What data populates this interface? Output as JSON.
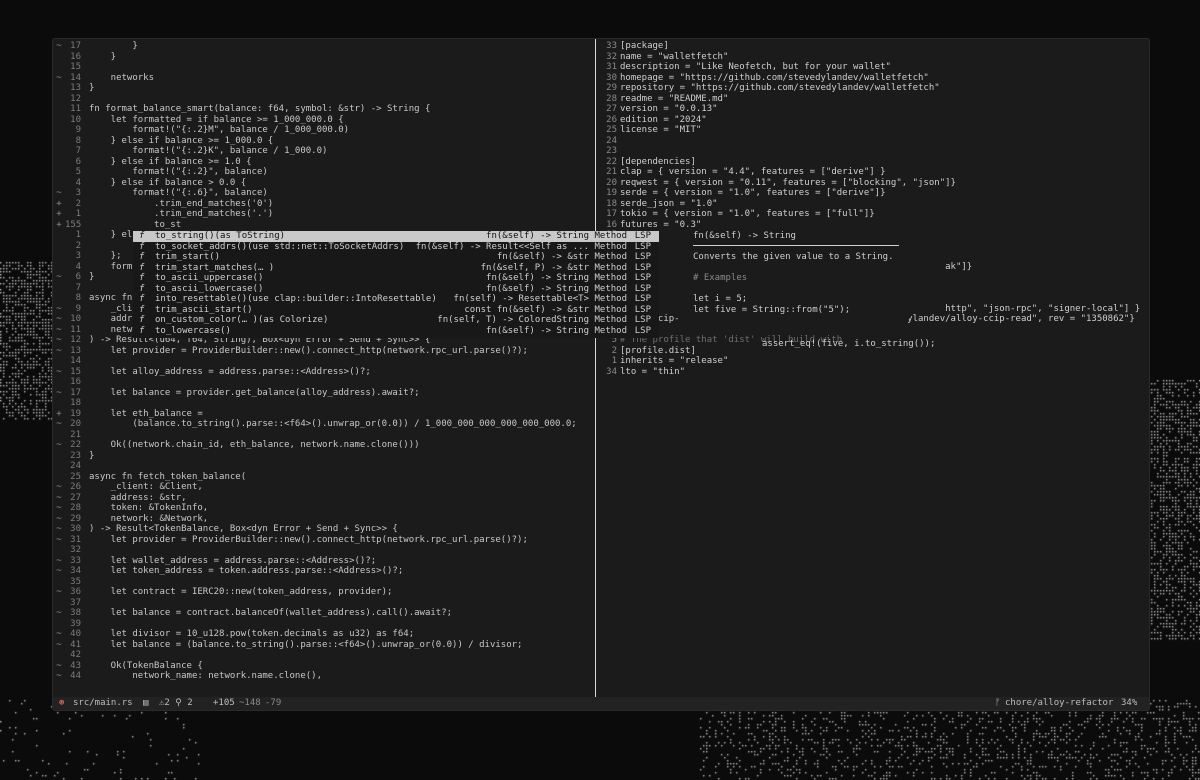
{
  "left_pane": {
    "lines": [
      {
        "g": "~",
        "n": "17",
        "t": "        }"
      },
      {
        "g": "",
        "n": "16",
        "t": "    }"
      },
      {
        "g": "",
        "n": "15",
        "t": ""
      },
      {
        "g": "~",
        "n": "14",
        "t": "    networks"
      },
      {
        "g": "",
        "n": "13",
        "t": "}"
      },
      {
        "g": "",
        "n": "12",
        "t": ""
      },
      {
        "g": "",
        "n": "11",
        "t": "fn format_balance_smart(balance: f64, symbol: &str) -> String {"
      },
      {
        "g": "",
        "n": "10",
        "t": "    let formatted = if balance >= 1_000_000.0 {"
      },
      {
        "g": "",
        "n": "9",
        "t": "        format!(\"{:.2}M\", balance / 1_000_000.0)"
      },
      {
        "g": "",
        "n": "8",
        "t": "    } else if balance >= 1_000.0 {"
      },
      {
        "g": "",
        "n": "7",
        "t": "        format!(\"{:.2}K\", balance / 1_000.0)"
      },
      {
        "g": "",
        "n": "6",
        "t": "    } else if balance >= 1.0 {"
      },
      {
        "g": "",
        "n": "5",
        "t": "        format!(\"{:.2}\", balance)"
      },
      {
        "g": "",
        "n": "4",
        "t": "    } else if balance > 0.0 {"
      },
      {
        "g": "~",
        "n": "3",
        "t": "        format!(\"{:.6}\", balance)"
      },
      {
        "g": "+",
        "n": "2",
        "t": "            .trim_end_matches('0')"
      },
      {
        "g": "+",
        "n": "1",
        "t": "            .trim_end_matches('.')"
      },
      {
        "g": "+",
        "n": "155",
        "t": "            to_st"
      },
      {
        "g": "",
        "n": "1",
        "t": "    } else"
      },
      {
        "g": "",
        "n": "2",
        "t": "        \""
      },
      {
        "g": "",
        "n": "3",
        "t": "    };"
      },
      {
        "g": "",
        "n": "4",
        "t": "    forma"
      },
      {
        "g": "~",
        "n": "6",
        "t": "}"
      },
      {
        "g": "",
        "n": "7",
        "t": ""
      },
      {
        "g": "",
        "n": "8",
        "t": "async fn"
      },
      {
        "g": "~",
        "n": "9",
        "t": "    _clie"
      },
      {
        "g": "~",
        "n": "10",
        "t": "    addre"
      },
      {
        "g": "~",
        "n": "11",
        "t": "    network: &Network,"
      },
      {
        "g": "~",
        "n": "12",
        "t": ") -> Result<(u64, f64, String), Box<dyn Error + Send + Sync>> {"
      },
      {
        "g": "~",
        "n": "13",
        "t": "    let provider = ProviderBuilder::new().connect_http(network.rpc_url.parse()?);"
      },
      {
        "g": "",
        "n": "14",
        "t": ""
      },
      {
        "g": "~",
        "n": "15",
        "t": "    let alloy_address = address.parse::<Address>()?;"
      },
      {
        "g": "",
        "n": "16",
        "t": ""
      },
      {
        "g": "~",
        "n": "17",
        "t": "    let balance = provider.get_balance(alloy_address).await?;"
      },
      {
        "g": "",
        "n": "18",
        "t": ""
      },
      {
        "g": "+",
        "n": "19",
        "t": "    let eth_balance ="
      },
      {
        "g": "~",
        "n": "20",
        "t": "        (balance.to_string().parse::<f64>().unwrap_or(0.0)) / 1_000_000_000_000_000_000.0;"
      },
      {
        "g": "",
        "n": "21",
        "t": ""
      },
      {
        "g": "~",
        "n": "22",
        "t": "    Ok((network.chain_id, eth_balance, network.name.clone()))"
      },
      {
        "g": "",
        "n": "23",
        "t": "}"
      },
      {
        "g": "",
        "n": "24",
        "t": ""
      },
      {
        "g": "",
        "n": "25",
        "t": "async fn fetch_token_balance("
      },
      {
        "g": "~",
        "n": "26",
        "t": "    _client: &Client,"
      },
      {
        "g": "~",
        "n": "27",
        "t": "    address: &str,"
      },
      {
        "g": "~",
        "n": "28",
        "t": "    token: &TokenInfo,"
      },
      {
        "g": "~",
        "n": "29",
        "t": "    network: &Network,"
      },
      {
        "g": "~",
        "n": "30",
        "t": ") -> Result<TokenBalance, Box<dyn Error + Send + Sync>> {"
      },
      {
        "g": "~",
        "n": "31",
        "t": "    let provider = ProviderBuilder::new().connect_http(network.rpc_url.parse()?);"
      },
      {
        "g": "",
        "n": "32",
        "t": ""
      },
      {
        "g": "~",
        "n": "33",
        "t": "    let wallet_address = address.parse::<Address>()?;"
      },
      {
        "g": "~",
        "n": "34",
        "t": "    let token_address = token.address.parse::<Address>()?;"
      },
      {
        "g": "",
        "n": "35",
        "t": ""
      },
      {
        "g": "~",
        "n": "36",
        "t": "    let contract = IERC20::new(token_address, provider);"
      },
      {
        "g": "",
        "n": "37",
        "t": ""
      },
      {
        "g": "~",
        "n": "38",
        "t": "    let balance = contract.balanceOf(wallet_address).call().await?;"
      },
      {
        "g": "",
        "n": "39",
        "t": ""
      },
      {
        "g": "~",
        "n": "40",
        "t": "    let divisor = 10_u128.pow(token.decimals as u32) as f64;"
      },
      {
        "g": "~",
        "n": "41",
        "t": "    let balance = (balance.to_string().parse::<f64>().unwrap_or(0.0)) / divisor;"
      },
      {
        "g": "",
        "n": "42",
        "t": ""
      },
      {
        "g": "~",
        "n": "43",
        "t": "    Ok(TokenBalance {"
      },
      {
        "g": "~",
        "n": "44",
        "t": "        network_name: network.name.clone(),"
      }
    ]
  },
  "right_pane": {
    "lines": [
      {
        "n": "33",
        "t": "[package]"
      },
      {
        "n": "32",
        "t": "name = \"walletfetch\""
      },
      {
        "n": "31",
        "t": "description = \"Like Neofetch, but for your wallet\""
      },
      {
        "n": "30",
        "t": "homepage = \"https://github.com/stevedylandev/walletfetch\""
      },
      {
        "n": "29",
        "t": "repository = \"https://github.com/stevedylandev/walletfetch\""
      },
      {
        "n": "28",
        "t": "readme = \"README.md\""
      },
      {
        "n": "27",
        "t": "version = \"0.0.13\""
      },
      {
        "n": "26",
        "t": "edition = \"2024\""
      },
      {
        "n": "25",
        "t": "license = \"MIT\""
      },
      {
        "n": "24",
        "t": ""
      },
      {
        "n": "23",
        "t": ""
      },
      {
        "n": "22",
        "t": "[dependencies]"
      },
      {
        "n": "21",
        "t": "clap = { version = \"4.4\", features = [\"derive\"] }"
      },
      {
        "n": "20",
        "t": "reqwest = { version = \"0.11\", features = [\"blocking\", \"json\"]}"
      },
      {
        "n": "19",
        "t": "serde = { version = \"1.0\", features = [\"derive\"]}"
      },
      {
        "n": "18",
        "t": "serde_json = \"1.0\""
      },
      {
        "n": "17",
        "t": "tokio = { version = \"1.0\", features = [\"full\"]}"
      },
      {
        "n": "16",
        "t": "futures = \"0.3\""
      },
      {
        "n": "15",
        "t": ""
      },
      {
        "n": "14",
        "t": ""
      },
      {
        "n": "13",
        "t": ""
      },
      {
        "n": "12",
        "t": "                                                            ak\"]}"
      },
      {
        "n": "11",
        "t": ""
      },
      {
        "n": "10",
        "t": ""
      },
      {
        "n": "9",
        "t": ""
      },
      {
        "n": "8",
        "t": "                                                            http\", \"json-rpc\", \"signer-local\"] }"
      },
      {
        "n": "7",
        "t": "alloy-ccip-                                          ylandev/alloy-ccip-read\", rev = \"1350862\"}"
      },
      {
        "n": "6",
        "t": ""
      },
      {
        "n": "5",
        "t": "# The profile that 'dist' will build with"
      },
      {
        "n": "2",
        "t": "[profile.dist]"
      },
      {
        "n": "1",
        "t": "inherits = \"release\""
      },
      {
        "n": "34",
        "t": "lto = \"thin\""
      }
    ]
  },
  "completion": {
    "items": [
      {
        "label": "to_string()(as ToString)",
        "detail": "fn(&self) -> String",
        "kind": "Method",
        "source": "LSP",
        "selected": true
      },
      {
        "label": "to_socket_addrs()(use std::net::ToSocketAddrs)",
        "detail": "fn(&self) -> Result<<Self as ...",
        "kind": "Method",
        "source": "LSP"
      },
      {
        "label": "trim_start()",
        "detail": "fn(&self) -> &str",
        "kind": "Method",
        "source": "LSP"
      },
      {
        "label": "trim_start_matches(… )",
        "detail": "fn(&self, P) -> &str",
        "kind": "Method",
        "source": "LSP"
      },
      {
        "label": "to_ascii_uppercase()",
        "detail": "fn(&self) -> String",
        "kind": "Method",
        "source": "LSP"
      },
      {
        "label": "to_ascii_lowercase()",
        "detail": "fn(&self) -> String",
        "kind": "Method",
        "source": "LSP"
      },
      {
        "label": "into_resettable()(use clap::builder::IntoResettable)",
        "detail": "fn(self) -> Resettable<T>",
        "kind": "Method",
        "source": "LSP"
      },
      {
        "label": "trim_ascii_start()",
        "detail": "const fn(&self) -> &str",
        "kind": "Method",
        "source": "LSP"
      },
      {
        "label": "on_custom_color(… )(as Colorize)",
        "detail": "fn(self, T) -> ColoredString",
        "kind": "Method",
        "source": "LSP"
      },
      {
        "label": "to_lowercase()",
        "detail": "fn(&self) -> String",
        "kind": "Method",
        "source": "LSP"
      }
    ],
    "kind_glyph": "f"
  },
  "doc_popup": {
    "signature": "fn(&self) -> String",
    "summary": "Converts the given value to a String.",
    "examples_heading": "# Examples",
    "code_1": "let i = 5;",
    "code_2": "let five = String::from(\"5\");",
    "code_3": "assert_eq!(five, i.to_string());"
  },
  "status_bar": {
    "file": "src/main.rs",
    "diagnostics": "⚠2 ⚲ 2",
    "added": "+105",
    "changed": "~148",
    "removed": "-79",
    "branch": "chore/alloy-refactor",
    "percent": "34%"
  },
  "colors": {
    "keyword": "#d0d0d0",
    "string": "#e8dcb8",
    "accent": "#e2786a",
    "muted": "#8a8a8a"
  }
}
